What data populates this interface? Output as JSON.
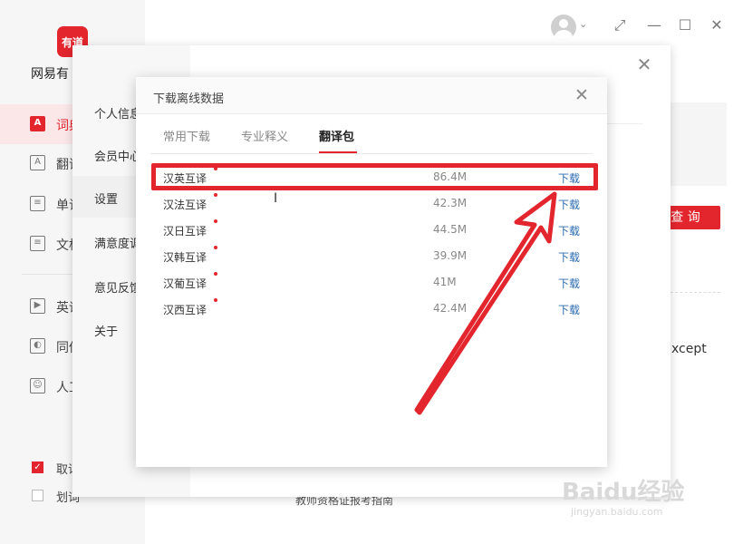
{
  "app": {
    "name": "网易有",
    "logo_text": "有道",
    "sidebar": [
      {
        "icon": "dictionary-icon",
        "icon_glyph": "A",
        "label": "词典",
        "active": true
      },
      {
        "icon": "translate-icon",
        "icon_glyph": "A",
        "label": "翻译",
        "active": false
      },
      {
        "icon": "wordbook-icon",
        "icon_glyph": "≡",
        "label": "单词",
        "active": false
      },
      {
        "icon": "document-icon",
        "icon_glyph": "≡",
        "label": "文档",
        "active": false
      },
      {
        "icon": "english-video-icon",
        "icon_glyph": "▶",
        "label": "英语",
        "active": false
      },
      {
        "icon": "simultaneous-icon",
        "icon_glyph": "◐",
        "label": "同传",
        "active": false
      },
      {
        "icon": "human-translate-icon",
        "icon_glyph": "☺",
        "label": "人工",
        "active": false
      }
    ],
    "sidebar_checks": [
      {
        "label": "取词",
        "checked": true
      },
      {
        "label": "划词",
        "checked": false
      }
    ],
    "query_button": "查 询",
    "bg_text_except": "xcept",
    "bg_text_guide": "教师资格证报考指南"
  },
  "window_controls": {
    "avatar_caret": "⌄",
    "restore": "⤢",
    "minimize": "—",
    "maximize": "☐",
    "close": "✕"
  },
  "settings": {
    "close": "✕",
    "nav": [
      {
        "label": "个人信息",
        "active": false
      },
      {
        "label": "会员中心",
        "active": false
      },
      {
        "label": "设置",
        "active": true
      },
      {
        "label": "满意度调",
        "active": false
      },
      {
        "label": "意见反馈",
        "active": false
      },
      {
        "label": "关于",
        "active": false
      }
    ]
  },
  "dialog": {
    "title": "下载离线数据",
    "close": "✕",
    "tabs": [
      {
        "label": "常用下载",
        "active": false
      },
      {
        "label": "专业释义",
        "active": false
      },
      {
        "label": "翻译包",
        "active": true
      }
    ],
    "rows": [
      {
        "name": "汉英互译",
        "size": "86.4M",
        "action": "下载"
      },
      {
        "name": "汉法互译",
        "size": "42.3M",
        "action": "下载"
      },
      {
        "name": "汉日互译",
        "size": "44.5M",
        "action": "下载"
      },
      {
        "name": "汉韩互译",
        "size": "39.9M",
        "action": "下载"
      },
      {
        "name": "汉葡互译",
        "size": "41M",
        "action": "下载"
      },
      {
        "name": "汉西互译",
        "size": "42.4M",
        "action": "下载"
      }
    ]
  },
  "annotation": {
    "color": "#e3262e",
    "highlighted_row": 0
  },
  "watermark": {
    "logo": "Baidu经验",
    "url": "jingyan.baidu.com"
  },
  "colors": {
    "accent": "#e3262e",
    "link": "#2b6cb0"
  }
}
